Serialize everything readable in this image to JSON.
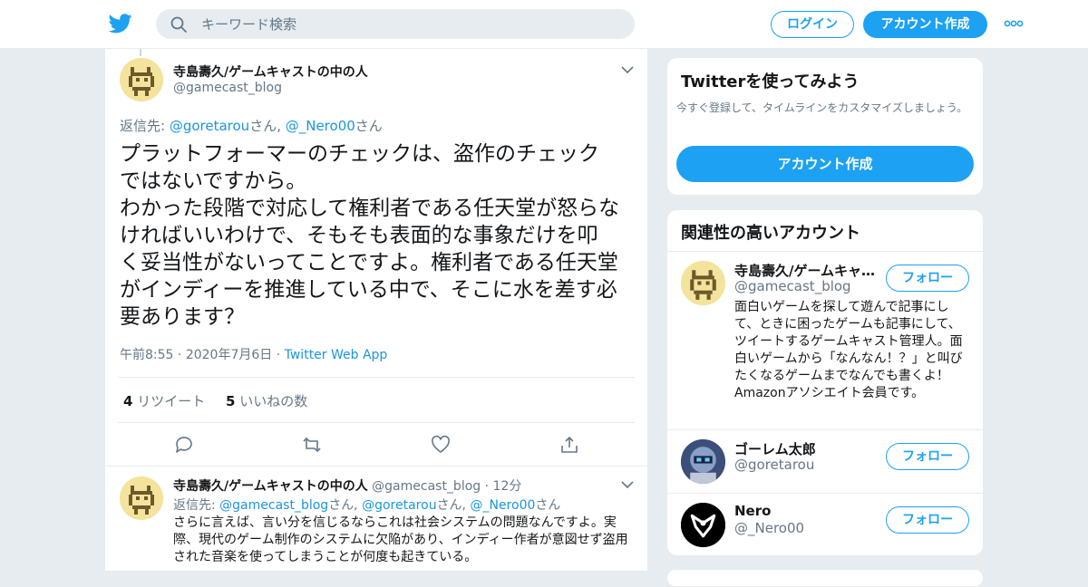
{
  "header": {
    "search_placeholder": "キーワード検索",
    "login_label": "ログイン",
    "signup_label": "アカウント作成"
  },
  "main_tweet": {
    "author_name": "寺島壽久/ゲームキャストの中の人",
    "author_handle": "@gamecast_blog",
    "reply_prefix": "返信先: ",
    "reply_user1": "@goretarou",
    "reply_san1": "さん, ",
    "reply_user2": "@_Nero00",
    "reply_san2": "さん",
    "text": "プラットフォーマーのチェックは、盗作のチェック\nではないですから。\nわかった段階で対応して権利者である任天堂が怒らな\nければいいわけで、そもそも表面的な事象だけを叩\nく妥当性がないってことですよ。権利者である任天堂\nがインディーを推進している中で、そこに水を差す必\n要あります？",
    "time": "午前8:55",
    "date": "2020年7月6日",
    "source": "Twitter Web App",
    "retweet_count": "4",
    "retweet_label": "リツイート",
    "like_count": "5",
    "like_label": "いいねの数"
  },
  "reply_tweet": {
    "author_name": "寺島壽久/ゲームキャストの中の人",
    "author_handle": "@gamecast_blog",
    "age": "12分",
    "reply_prefix": "返信先: ",
    "reply_user1": "@gamecast_blog",
    "reply_san1": "さん, ",
    "reply_user2": "@goretarou",
    "reply_san2": "さん, ",
    "reply_user3": "@_Nero00",
    "reply_san3": "さん",
    "text": "さらに言えば、言い分を信じるならこれは社会システムの問題なんですよ。実際、現代のゲーム制作のシステムに欠陥があり、インディー作者が意図せず盗用された音楽を使ってしまうことが何度も起きている。"
  },
  "sidebar": {
    "try_title": "Twitterを使ってみよう",
    "try_subtitle": "今すぐ登録して、タイムラインをカスタマイズしましょう。",
    "try_button": "アカウント作成",
    "related_title": "関連性の高いアカウント",
    "accounts": [
      {
        "name": "寺島壽久/ゲームキャ…",
        "handle": "@gamecast_blog",
        "follow_label": "フォロー",
        "bio": "面白いゲームを探して遊んで記事にして、ときに困ったゲームも記事にして、ツイートするゲームキャスト管理人。面白いゲームから「なんなん！？」と叫びたくなるゲームまでなんでも書くよ！ Amazonアソシエイト会員です。"
      },
      {
        "name": "ゴーレム太郎",
        "handle": "@goretarou",
        "follow_label": "フォロー"
      },
      {
        "name": "Nero",
        "handle": "@_Nero00",
        "follow_label": "フォロー"
      }
    ]
  },
  "colors": {
    "accent": "#1da1f2",
    "link": "#1b95e0",
    "muted": "#657786",
    "background": "#e6ecf0"
  }
}
